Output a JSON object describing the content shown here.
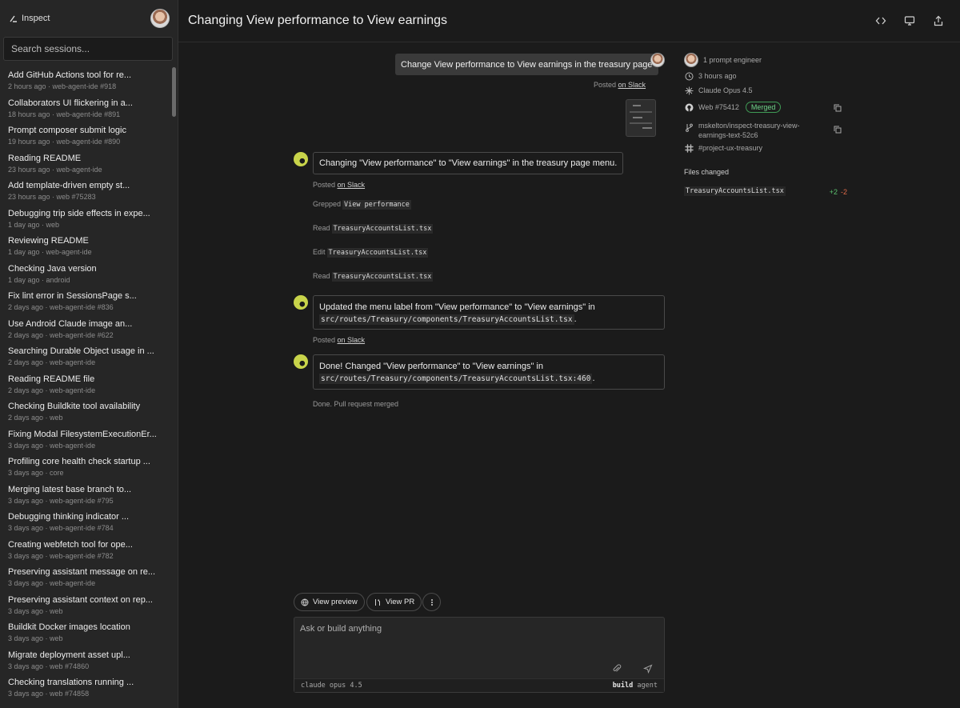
{
  "sidebar": {
    "brand": "Inspect",
    "search_placeholder": "Search sessions...",
    "sessions": [
      {
        "title": "Add GitHub Actions tool for re...",
        "meta": "2 hours ago · web-agent-ide #918"
      },
      {
        "title": "Collaborators UI flickering in a...",
        "meta": "18 hours ago · web-agent-ide #891"
      },
      {
        "title": "Prompt composer submit logic",
        "meta": "19 hours ago · web-agent-ide #890"
      },
      {
        "title": "Reading README",
        "meta": "23 hours ago · web-agent-ide"
      },
      {
        "title": "Add template-driven empty st...",
        "meta": "23 hours ago · web #75283"
      },
      {
        "title": "Debugging trip side effects in expe...",
        "meta": "1 day ago · web"
      },
      {
        "title": "Reviewing README",
        "meta": "1 day ago · web-agent-ide"
      },
      {
        "title": "Checking Java version",
        "meta": "1 day ago · android"
      },
      {
        "title": "Fix lint error in SessionsPage s...",
        "meta": "2 days ago · web-agent-ide #836"
      },
      {
        "title": "Use Android Claude image an...",
        "meta": "2 days ago · web-agent-ide #622"
      },
      {
        "title": "Searching Durable Object usage in ...",
        "meta": "2 days ago · web-agent-ide"
      },
      {
        "title": "Reading README file",
        "meta": "2 days ago · web-agent-ide"
      },
      {
        "title": "Checking Buildkite tool availability",
        "meta": "2 days ago · web"
      },
      {
        "title": "Fixing Modal FilesystemExecutionEr...",
        "meta": "3 days ago · web-agent-ide"
      },
      {
        "title": "Profiling core health check startup ...",
        "meta": "3 days ago · core"
      },
      {
        "title": "Merging latest base branch to...",
        "meta": "3 days ago · web-agent-ide #795"
      },
      {
        "title": "Debugging thinking indicator ...",
        "meta": "3 days ago · web-agent-ide #784"
      },
      {
        "title": "Creating webfetch tool for ope...",
        "meta": "3 days ago · web-agent-ide #782"
      },
      {
        "title": "Preserving assistant message on re...",
        "meta": "3 days ago · web-agent-ide"
      },
      {
        "title": "Preserving assistant context on rep...",
        "meta": "3 days ago · web"
      },
      {
        "title": "Buildkit Docker images location",
        "meta": "3 days ago · web"
      },
      {
        "title": "Migrate deployment asset upl...",
        "meta": "3 days ago · web #74860"
      },
      {
        "title": "Checking translations running ...",
        "meta": "3 days ago · web #74858"
      }
    ]
  },
  "header": {
    "title": "Changing View performance to View earnings"
  },
  "chat": {
    "user_message": "Change View performance to View earnings in the treasury page",
    "posted_prefix": "Posted ",
    "posted_link": "on Slack",
    "reply1": "Changing \"View performance\" to \"View earnings\" in the treasury page menu.",
    "tools": [
      {
        "verb": "Grepped",
        "arg": "View performance"
      },
      {
        "verb": "Read",
        "arg": "TreasuryAccountsList.tsx"
      },
      {
        "verb": "Edit",
        "arg": "TreasuryAccountsList.tsx"
      },
      {
        "verb": "Read",
        "arg": "TreasuryAccountsList.tsx"
      }
    ],
    "reply2_text": "Updated the menu label from \"View performance\" to \"View earnings\" in",
    "reply2_code": "src/routes/Treasury/components/TreasuryAccountsList.tsx",
    "reply3_text": "Done! Changed \"View performance\" to \"View earnings\" in",
    "reply3_code": "src/routes/Treasury/components/TreasuryAccountsList.tsx:460",
    "period": ".",
    "done_note": "Done. Pull request merged"
  },
  "actions": {
    "view_preview": "View preview",
    "view_pr": "View PR"
  },
  "composer": {
    "placeholder": "Ask or build anything",
    "model": "claude opus 4.5",
    "mode_bold": "build",
    "mode_rest": "agent"
  },
  "details": {
    "participants": "1 prompt engineer",
    "time": "3 hours ago",
    "model": "Claude Opus 4.5",
    "pr": "Web #75412",
    "pr_status": "Merged",
    "branch_line1": "mskelton/inspect-treasury-view-",
    "branch_line2": "earnings-text-52c6",
    "channel": "#project-ux-treasury",
    "files_label": "Files changed",
    "files": [
      {
        "name": "TreasuryAccountsList.tsx",
        "additions": "+2",
        "deletions": "-2"
      }
    ]
  },
  "colors": {
    "background": "#1b1b1b",
    "sidebar": "#262626",
    "merged": "#6fd58a",
    "additions": "#5bc26f",
    "deletions": "#e06b4a"
  }
}
